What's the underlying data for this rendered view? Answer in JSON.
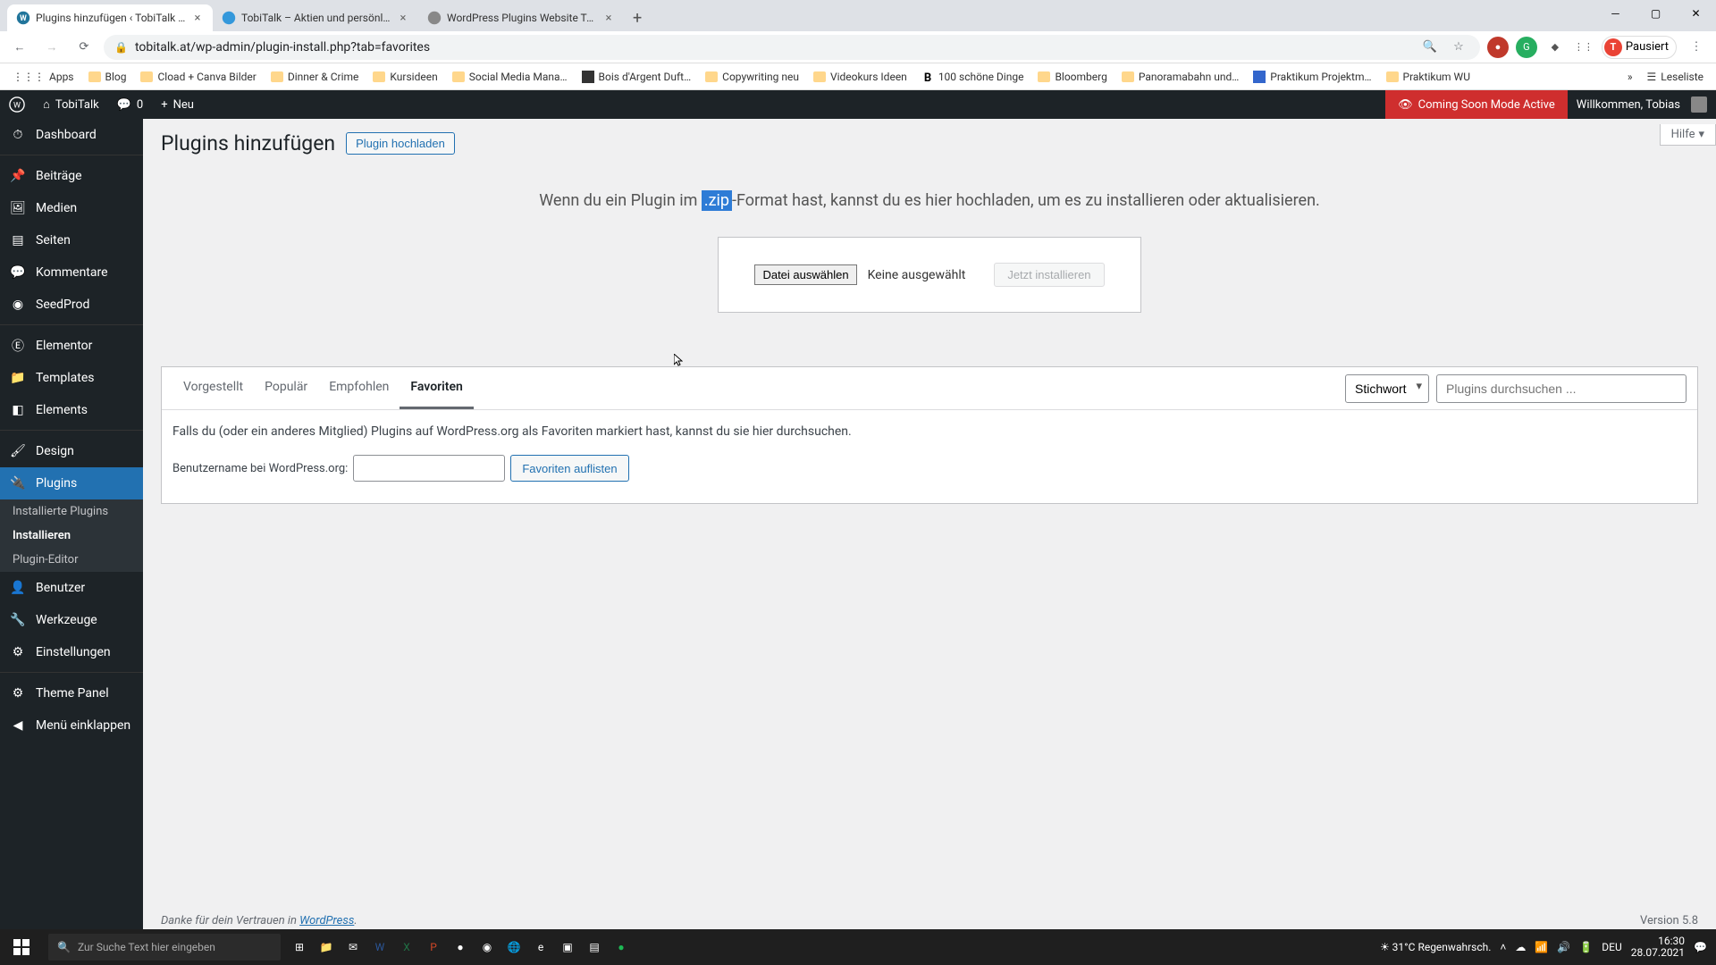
{
  "browser": {
    "tabs": [
      {
        "title": "Plugins hinzufügen ‹ TobiTalk —",
        "active": true
      },
      {
        "title": "TobiTalk – Aktien und persönlich",
        "active": false
      },
      {
        "title": "WordPress Plugins Website Tem",
        "active": false
      }
    ],
    "url": "tobitalk.at/wp-admin/plugin-install.php?tab=favorites",
    "profile_label": "Pausiert",
    "bookmarks": [
      "Apps",
      "Blog",
      "Cload + Canva Bilder",
      "Dinner & Crime",
      "Kursideen",
      "Social Media Mana…",
      "Bois d'Argent Duft…",
      "Copywriting neu",
      "Videokurs Ideen",
      "100 schöne Dinge",
      "Bloomberg",
      "Panoramabahn und…",
      "Praktikum Projektm…",
      "Praktikum WU"
    ],
    "reading_list": "Leseliste"
  },
  "wp_bar": {
    "site": "TobiTalk",
    "comments": "0",
    "new": "Neu",
    "coming_soon": "Coming Soon Mode Active",
    "welcome": "Willkommen, Tobias"
  },
  "sidebar": {
    "items": [
      {
        "label": "Dashboard",
        "icon": "dashboard"
      },
      {
        "label": "Beiträge",
        "icon": "pin"
      },
      {
        "label": "Medien",
        "icon": "media"
      },
      {
        "label": "Seiten",
        "icon": "pages"
      },
      {
        "label": "Kommentare",
        "icon": "comments"
      },
      {
        "label": "SeedProd",
        "icon": "seedprod"
      },
      {
        "label": "Elementor",
        "icon": "elementor"
      },
      {
        "label": "Templates",
        "icon": "templates"
      },
      {
        "label": "Elements",
        "icon": "elements"
      },
      {
        "label": "Design",
        "icon": "design"
      },
      {
        "label": "Plugins",
        "icon": "plugins",
        "current": true,
        "sub": [
          {
            "label": "Installierte Plugins"
          },
          {
            "label": "Installieren",
            "current": true
          },
          {
            "label": "Plugin-Editor"
          }
        ]
      },
      {
        "label": "Benutzer",
        "icon": "users"
      },
      {
        "label": "Werkzeuge",
        "icon": "tools"
      },
      {
        "label": "Einstellungen",
        "icon": "settings"
      },
      {
        "label": "Theme Panel",
        "icon": "theme"
      },
      {
        "label": "Menü einklappen",
        "icon": "collapse"
      }
    ]
  },
  "page": {
    "title": "Plugins hinzufügen",
    "upload_btn": "Plugin hochladen",
    "help": "Hilfe",
    "upload_desc_pre": "Wenn du ein Plugin im ",
    "upload_desc_zip": ".zip",
    "upload_desc_post": "-Format hast, kannst du es hier hochladen, um es zu installieren oder aktualisieren.",
    "file_btn": "Datei auswählen",
    "file_status": "Keine ausgewählt",
    "install_btn": "Jetzt installieren",
    "tabs": [
      "Vorgestellt",
      "Populär",
      "Empfohlen",
      "Favoriten"
    ],
    "active_tab": "Favoriten",
    "search_select": "Stichwort",
    "search_placeholder": "Plugins durchsuchen ...",
    "fav_desc": "Falls du (oder ein anderes Mitglied) Plugins auf WordPress.org als Favoriten markiert hast, kannst du sie hier durchsuchen.",
    "fav_label": "Benutzername bei WordPress.org:",
    "fav_btn": "Favoriten auflisten",
    "footer_thanks": "Danke für dein Vertrauen in ",
    "footer_link": "WordPress",
    "version": "Version 5.8"
  },
  "taskbar": {
    "search_placeholder": "Zur Suche Text hier eingeben",
    "weather_temp": "31°C",
    "weather_text": "Regenwahrsch.",
    "lang": "DEU",
    "time": "16:30",
    "date": "28.07.2021"
  }
}
